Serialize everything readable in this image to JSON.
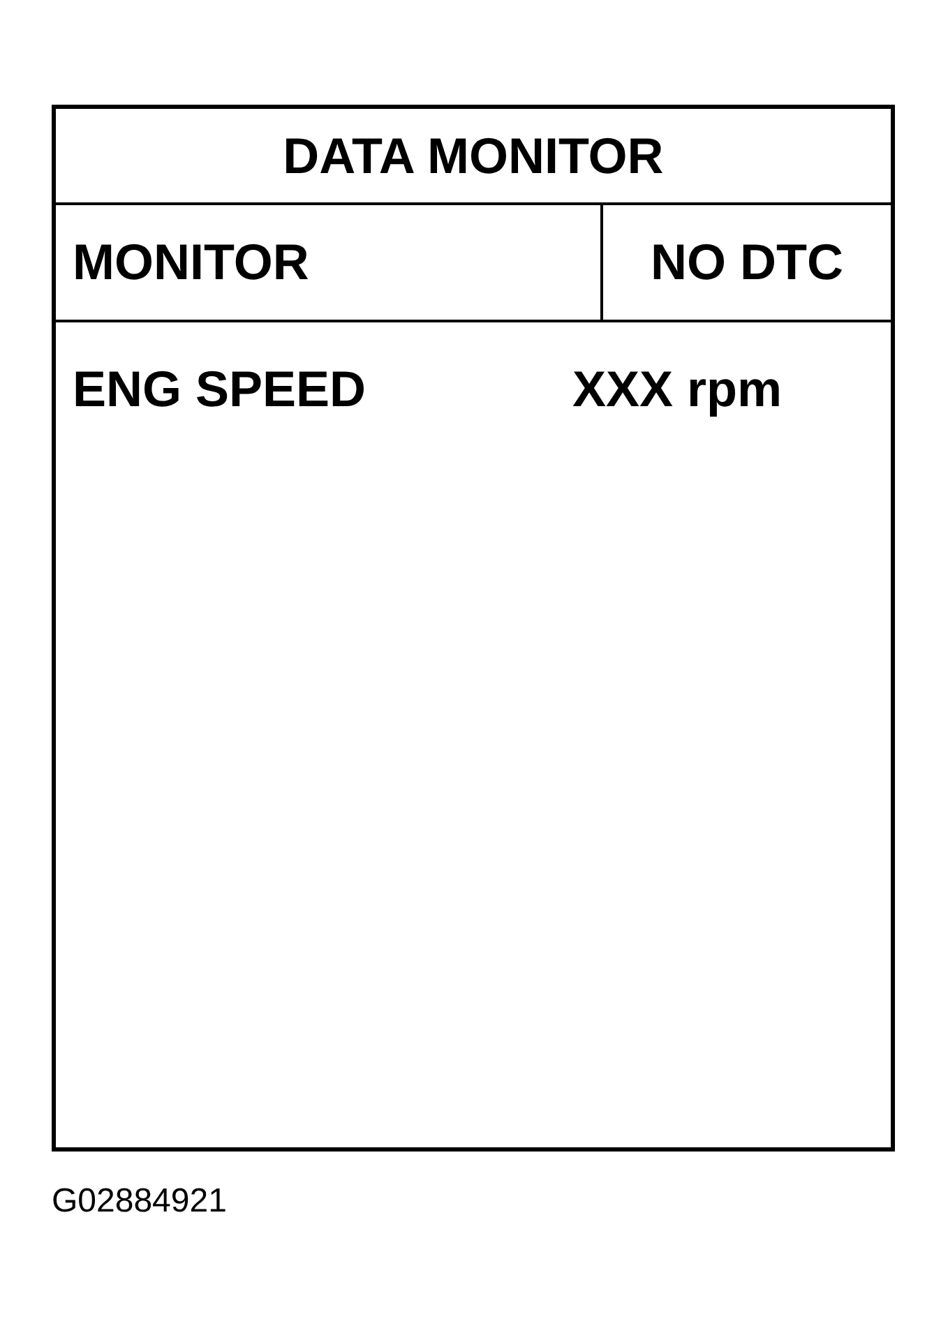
{
  "panel": {
    "title": "DATA MONITOR",
    "header": {
      "mode": "MONITOR",
      "status": "NO DTC"
    },
    "rows": [
      {
        "label": "ENG SPEED",
        "value": "XXX rpm"
      }
    ]
  },
  "figure_id": "G02884921"
}
